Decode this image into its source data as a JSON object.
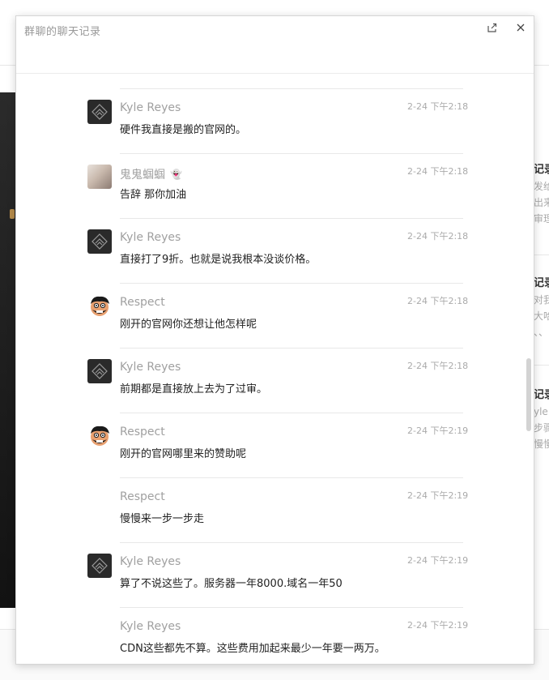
{
  "popup": {
    "title": "群聊的聊天记录"
  },
  "background": {
    "right_panel": [
      {
        "title": "记录",
        "lines": [
          "发给",
          "出来",
          "审理"
        ]
      },
      {
        "title": "记录",
        "lines": [
          "对我",
          "大哈",
          "、、"
        ]
      },
      {
        "title": "记录",
        "lines": [
          "yle I",
          "步骤",
          "慢慢"
        ]
      }
    ]
  },
  "messages": [
    {
      "sender": "Kyle Reyes",
      "avatar": "kyle-avatar",
      "time": "2-24 下午2:18",
      "text": "硬件我直接是搬的官网的。"
    },
    {
      "sender": "鬼鬼蝈蝈",
      "badge": "👻",
      "avatar": "ghost-avatar",
      "time": "2-24 下午2:18",
      "text": "告辞 那你加油"
    },
    {
      "sender": "Kyle Reyes",
      "avatar": "kyle-avatar",
      "time": "2-24 下午2:18",
      "text": "直接打了9折。也就是说我根本没谈价格。"
    },
    {
      "sender": "Respect",
      "avatar": "respect-avatar",
      "time": "2-24 下午2:18",
      "text": "刚开的官网你还想让他怎样呢"
    },
    {
      "sender": "Kyle Reyes",
      "avatar": "kyle-avatar",
      "time": "2-24 下午2:18",
      "text": "前期都是直接放上去为了过审。"
    },
    {
      "sender": "Respect",
      "avatar": "respect-avatar",
      "time": "2-24 下午2:19",
      "text": "刚开的官网哪里来的赞助呢"
    },
    {
      "sender": "Respect",
      "avatar": "",
      "time": "2-24 下午2:19",
      "text": "慢慢来一步一步走"
    },
    {
      "sender": "Kyle Reyes",
      "avatar": "kyle-avatar",
      "time": "2-24 下午2:19",
      "text": "算了不说这些了。服务器一年8000.域名一年50"
    },
    {
      "sender": "Kyle Reyes",
      "avatar": "",
      "time": "2-24 下午2:19",
      "text": "CDN这些都先不算。这些费用加起来最少一年要一两万。"
    }
  ]
}
